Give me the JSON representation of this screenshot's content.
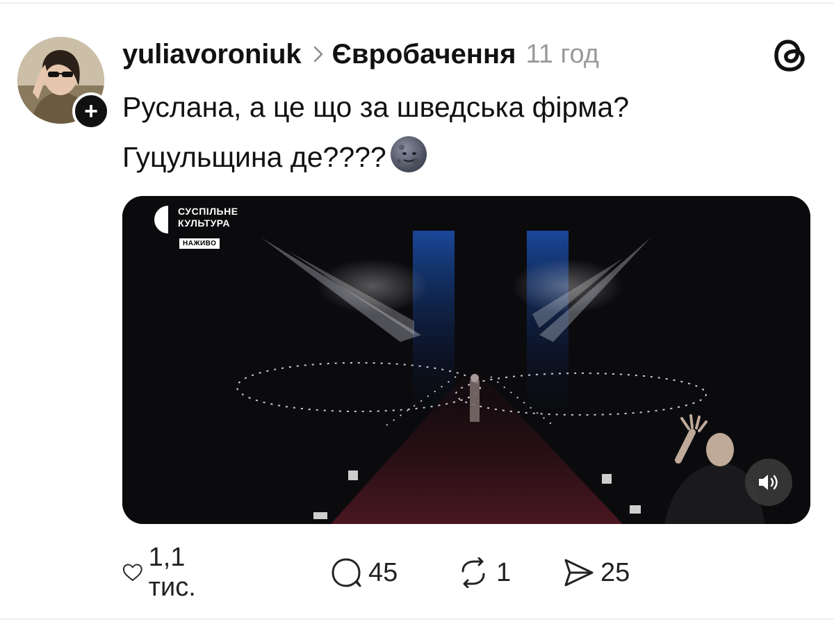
{
  "post": {
    "author": "yuliavoroniuk",
    "community": "Євробачення",
    "time": "11 год",
    "text_lines": [
      "Руслана, а це що за шведська фірма?",
      "Гуцульщина де????"
    ],
    "emoji": "new-moon-face"
  },
  "video": {
    "brand_line1": "СУСПІЛЬНЕ",
    "brand_line2": "КУЛЬТУРА",
    "live_label": "НАЖИВО"
  },
  "actions": {
    "likes": "1,1 тис.",
    "comments": "45",
    "reposts": "1",
    "shares": "25"
  },
  "icons": {
    "avatar": "avatar",
    "follow": "plus-icon",
    "chevron": "chevron-right-icon",
    "app_logo": "threads-logo-icon",
    "sound": "speaker-icon",
    "like": "heart-icon",
    "comment": "comment-icon",
    "repost": "repost-icon",
    "share": "send-icon"
  }
}
